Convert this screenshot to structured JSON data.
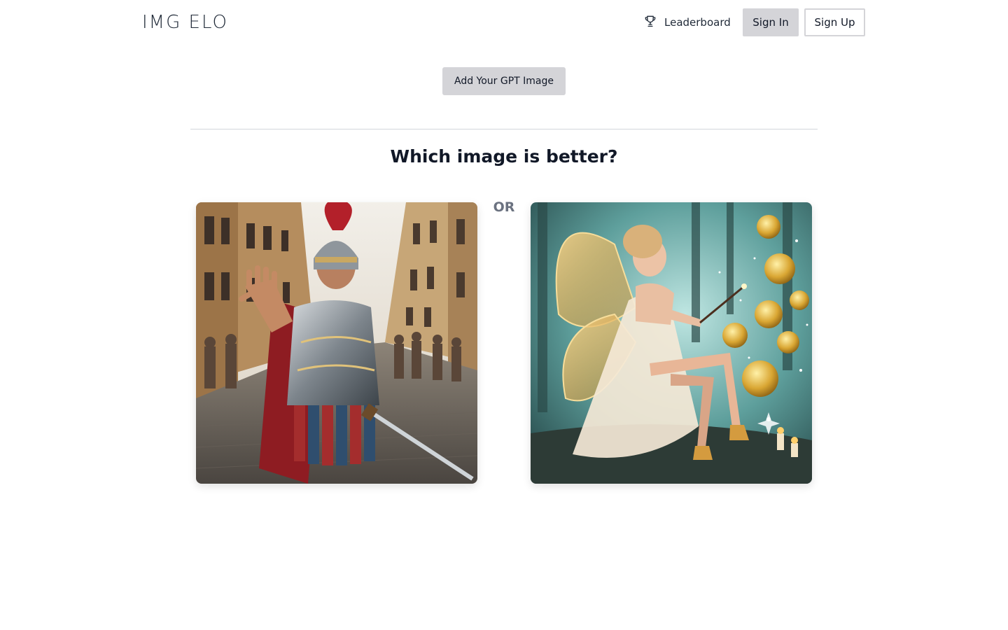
{
  "header": {
    "logo": "IMG ELO",
    "leaderboard_label": "Leaderboard",
    "leaderboard_icon": "trophy-icon",
    "signin_label": "Sign In",
    "signup_label": "Sign Up"
  },
  "actions": {
    "add_image_label": "Add Your GPT Image"
  },
  "comparison": {
    "question": "Which image is better?",
    "or_label": "OR",
    "left_image": "roman-centurion-image",
    "right_image": "fairy-coins-image"
  },
  "colors": {
    "button_gray": "#d4d4d8",
    "text_dark": "#111827",
    "or_gray": "#6b7280"
  }
}
